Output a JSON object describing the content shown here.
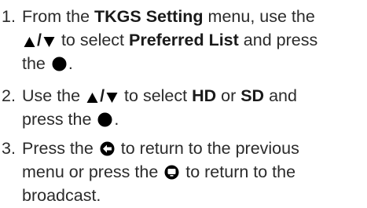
{
  "colors": {
    "text": "#2b2b2b",
    "icon": "#000000"
  },
  "icons": {
    "up": "up-triangle-icon",
    "down": "down-triangle-icon",
    "ok": "ok-button-icon",
    "back": "back-arrow-icon",
    "exit": "exit-button-icon"
  },
  "steps": [
    {
      "number": "1.",
      "t1": "From the ",
      "b1": "TKGS Setting",
      "t2": " menu, use the",
      "sep": "/",
      "t3": " to select ",
      "b2": "Preferred List",
      "t4": " and press",
      "t5": "the ",
      "t6": "."
    },
    {
      "number": "2.",
      "t1": "Use the ",
      "sep": "/",
      "t2": " to select ",
      "b1": "HD",
      "t3": " or ",
      "b2": "SD",
      "t4": " and",
      "t5": "press the ",
      "t6": "."
    },
    {
      "number": "3.",
      "t1": "Press the ",
      "t2": " to return to the previous",
      "t3": "menu or press the ",
      "t4": " to return to the",
      "t5": "broadcast."
    }
  ]
}
